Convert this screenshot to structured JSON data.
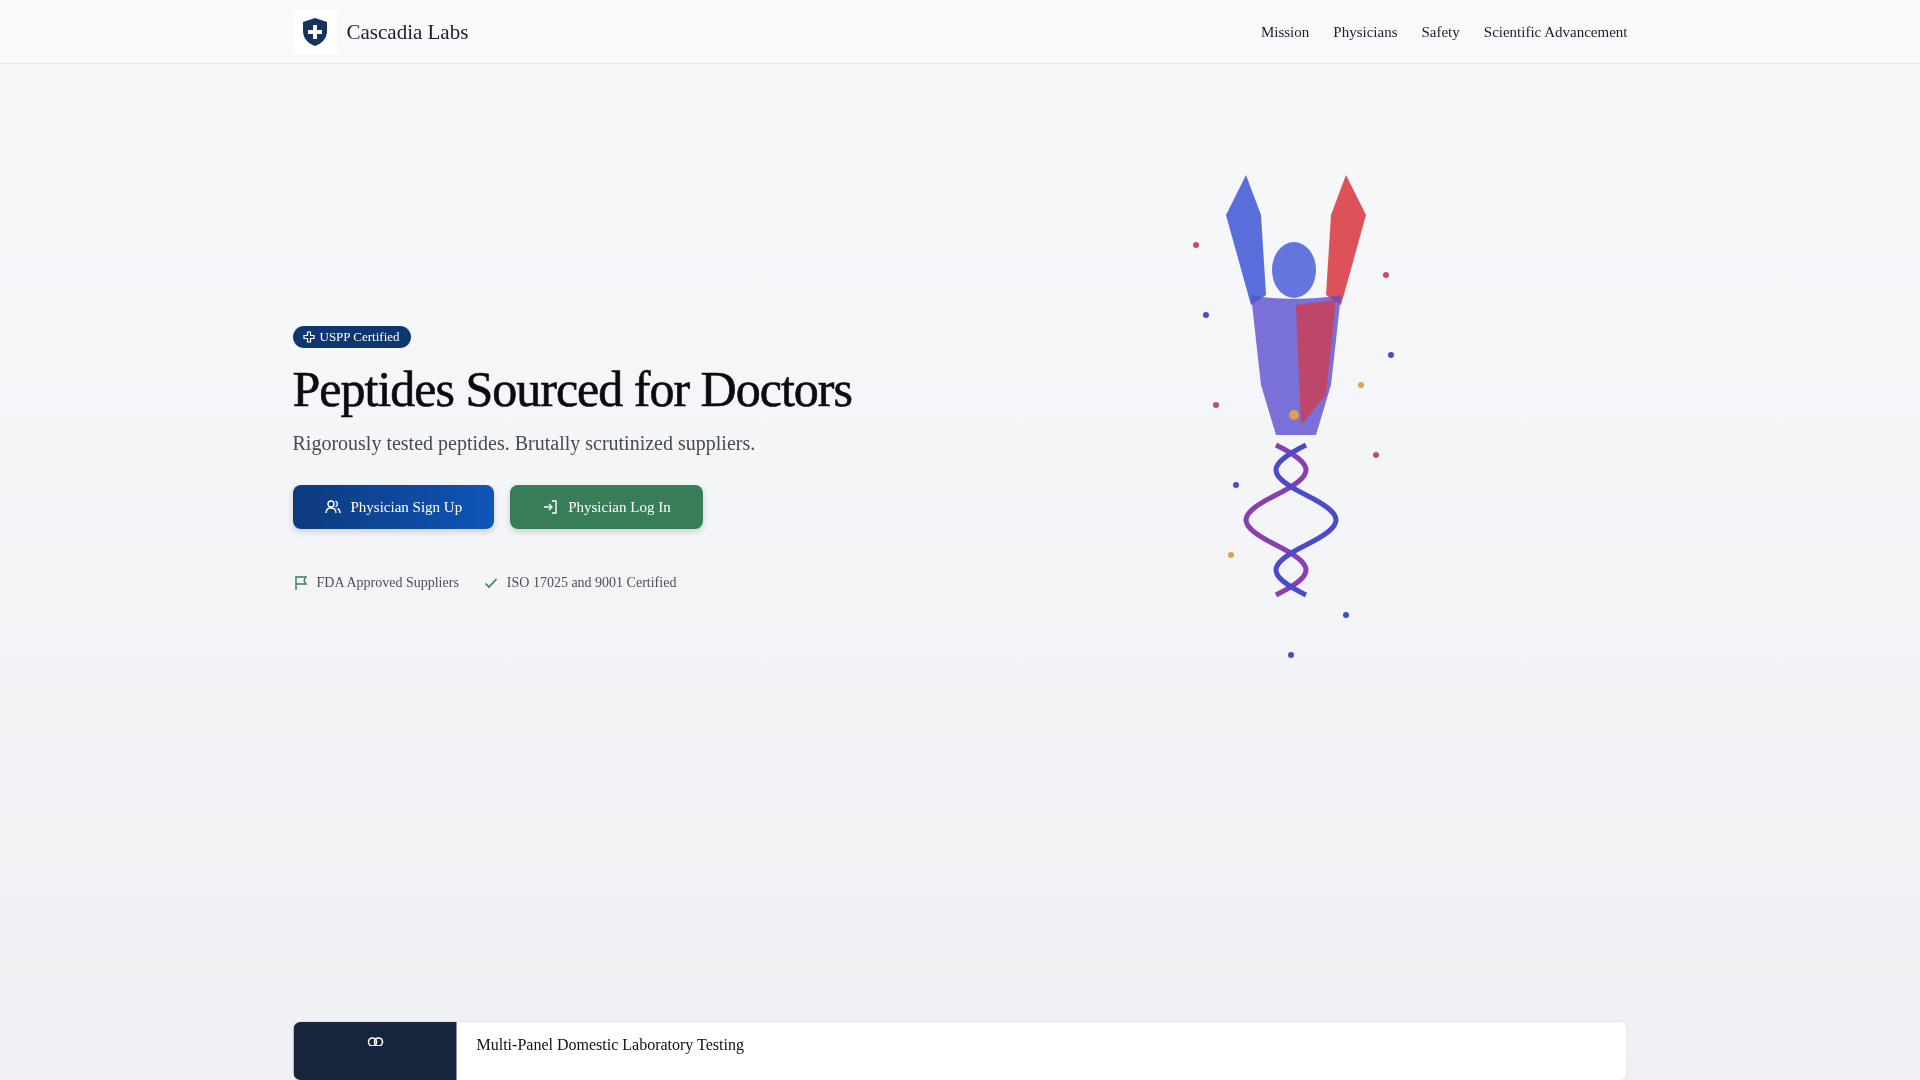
{
  "header": {
    "brand": "Cascadia Labs",
    "nav": [
      "Mission",
      "Physicians",
      "Safety",
      "Scientific Advancement"
    ]
  },
  "hero": {
    "badge": "USPP Certified",
    "title": "Peptides Sourced for Doctors",
    "subtitle": "Rigorously tested peptides. Brutally scrutinized suppliers.",
    "buttons": [
      {
        "label": "Physician Sign Up",
        "kind": "primary"
      },
      {
        "label": "Physician Log In",
        "kind": "secondary"
      }
    ],
    "features": [
      {
        "label": "FDA Approved Suppliers",
        "kind": "flag"
      },
      {
        "label": "ISO 17025 and 9001 Certified",
        "kind": "check"
      }
    ]
  },
  "card": {
    "title": "Multi-Panel Domestic Laboratory Testing"
  }
}
